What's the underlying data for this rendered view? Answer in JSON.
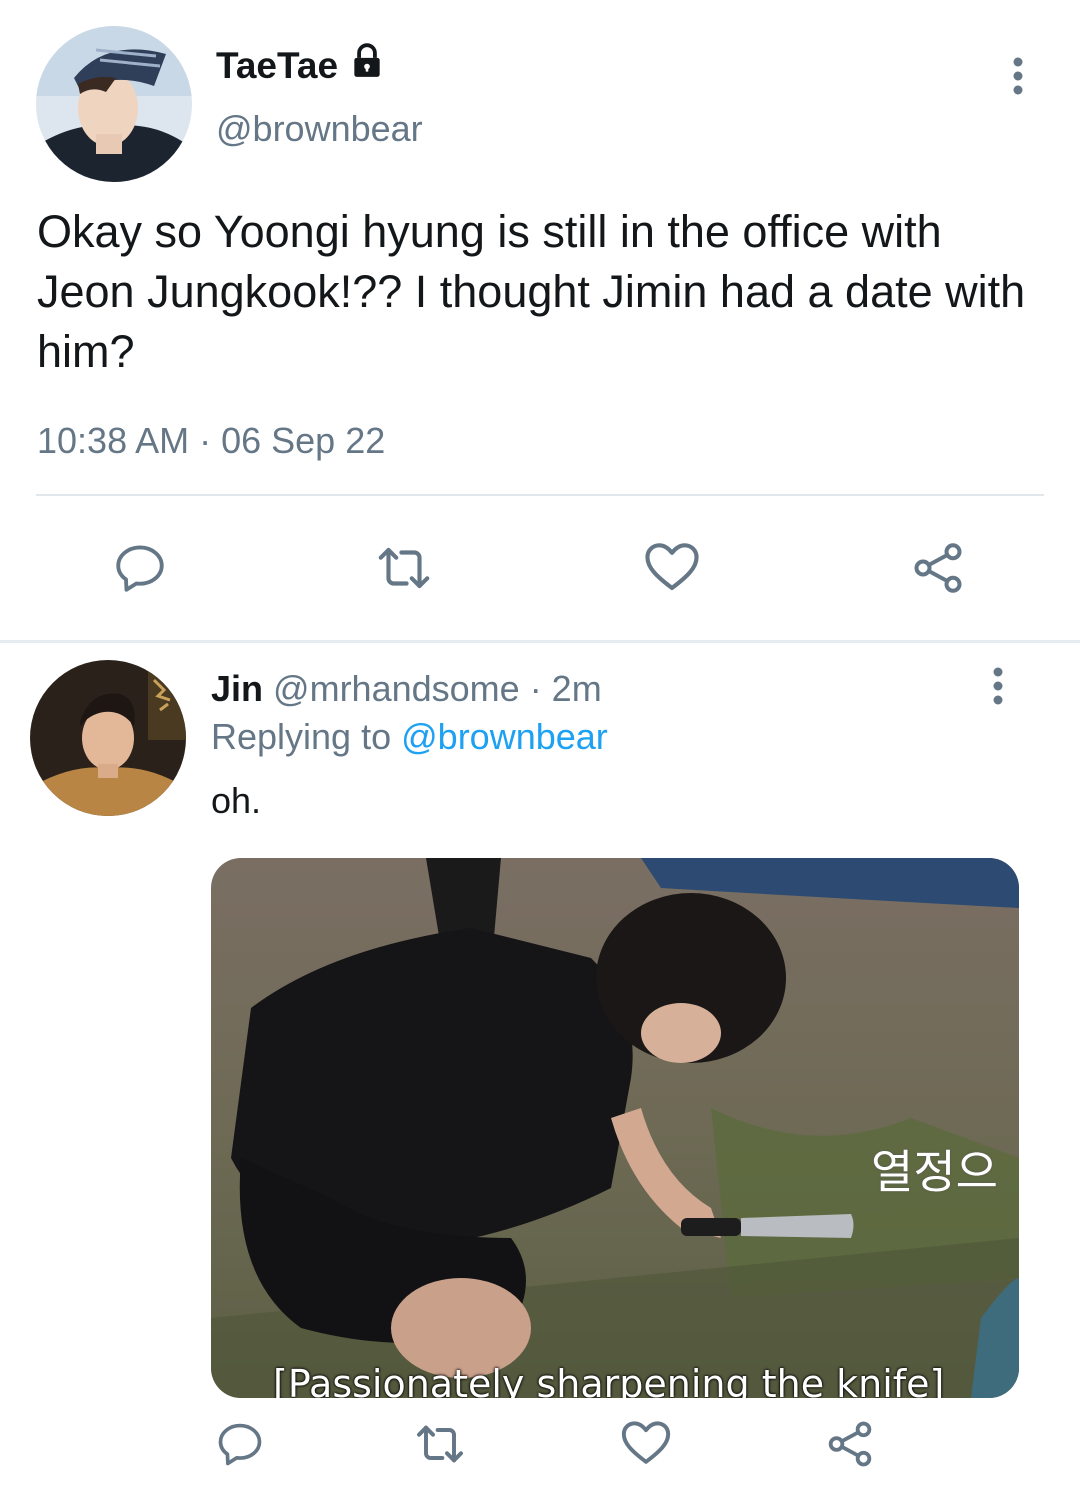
{
  "tweet": {
    "display_name": "TaeTae",
    "locked": true,
    "handle": "@brownbear",
    "text": "Okay so Yoongi hyung is still in the office with Jeon Jungkook!?? I thought Jimin had a date with him?",
    "timestamp": "10:38 AM · 06 Sep 22"
  },
  "actions": [
    "reply-icon",
    "retweet-icon",
    "like-icon",
    "share-icon"
  ],
  "reply": {
    "display_name": "Jin",
    "handle": "@mrhandsome",
    "time": "· 2m",
    "replying_prefix": "Replying to",
    "replying_to": "@brownbear",
    "text": "oh.",
    "media": {
      "caption": "[Passionately sharpening the knife]",
      "overlay_text": "열정으"
    }
  },
  "colors": {
    "text": "#14171a",
    "secondary": "#657786",
    "link": "#1da1f2",
    "icon": "#657786",
    "divider": "#e1e8ed"
  }
}
